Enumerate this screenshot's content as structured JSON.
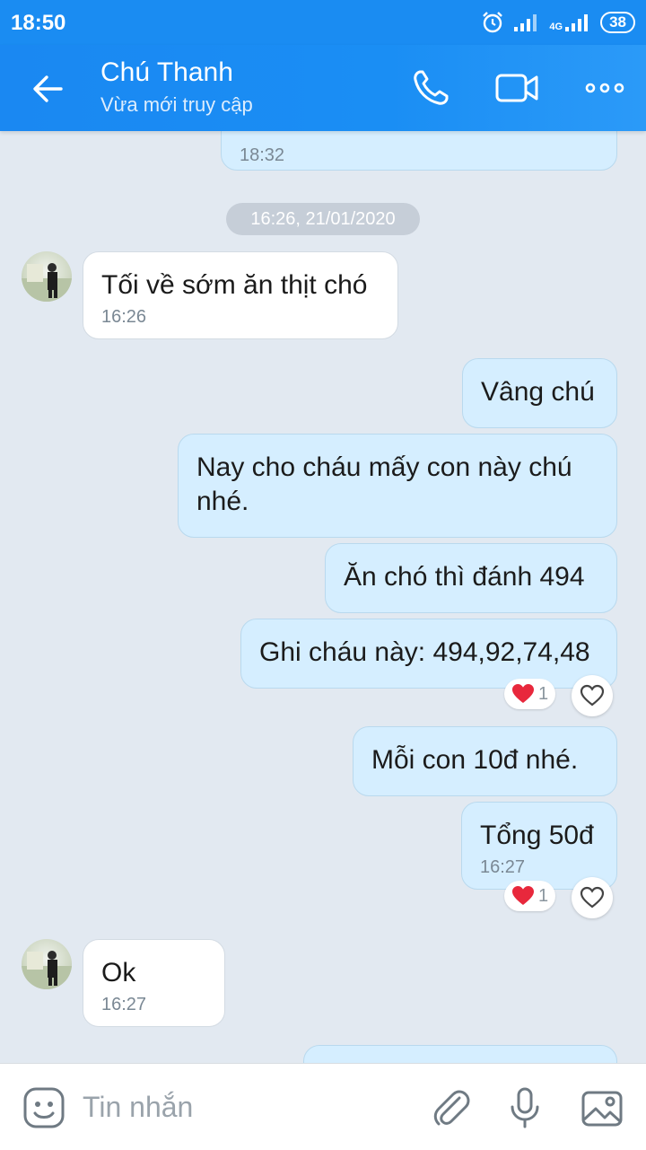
{
  "status_bar": {
    "time": "18:50",
    "network": "4G",
    "battery": "38"
  },
  "header": {
    "contact_name": "Chú Thanh",
    "contact_status": "Vừa mới truy cập"
  },
  "chat": {
    "prev_time": "18:32",
    "date_separator": "16:26, 21/01/2020",
    "messages": [
      {
        "from": "them",
        "text": "Tối về sớm ăn thịt chó",
        "time": "16:26"
      },
      {
        "from": "me",
        "text": "Vâng chú"
      },
      {
        "from": "me",
        "text": "Nay cho cháu mấy con này chú nhé."
      },
      {
        "from": "me",
        "text": "Ăn chó thì đánh 494"
      },
      {
        "from": "me",
        "text": "Ghi cháu này: 494,92,74,48",
        "reaction_count": "1"
      },
      {
        "from": "me",
        "text": "Mỗi con 10đ nhé."
      },
      {
        "from": "me",
        "text": "Tổng 50đ",
        "time": "16:27",
        "reaction_count": "1"
      },
      {
        "from": "them",
        "text": "Ok",
        "time": "16:27"
      }
    ]
  },
  "input": {
    "placeholder": "Tin nhắn"
  },
  "colors": {
    "accent": "#1a8cf2",
    "my_bubble": "#d5eeff",
    "their_bubble": "#ffffff",
    "heart": "#e8283c"
  }
}
